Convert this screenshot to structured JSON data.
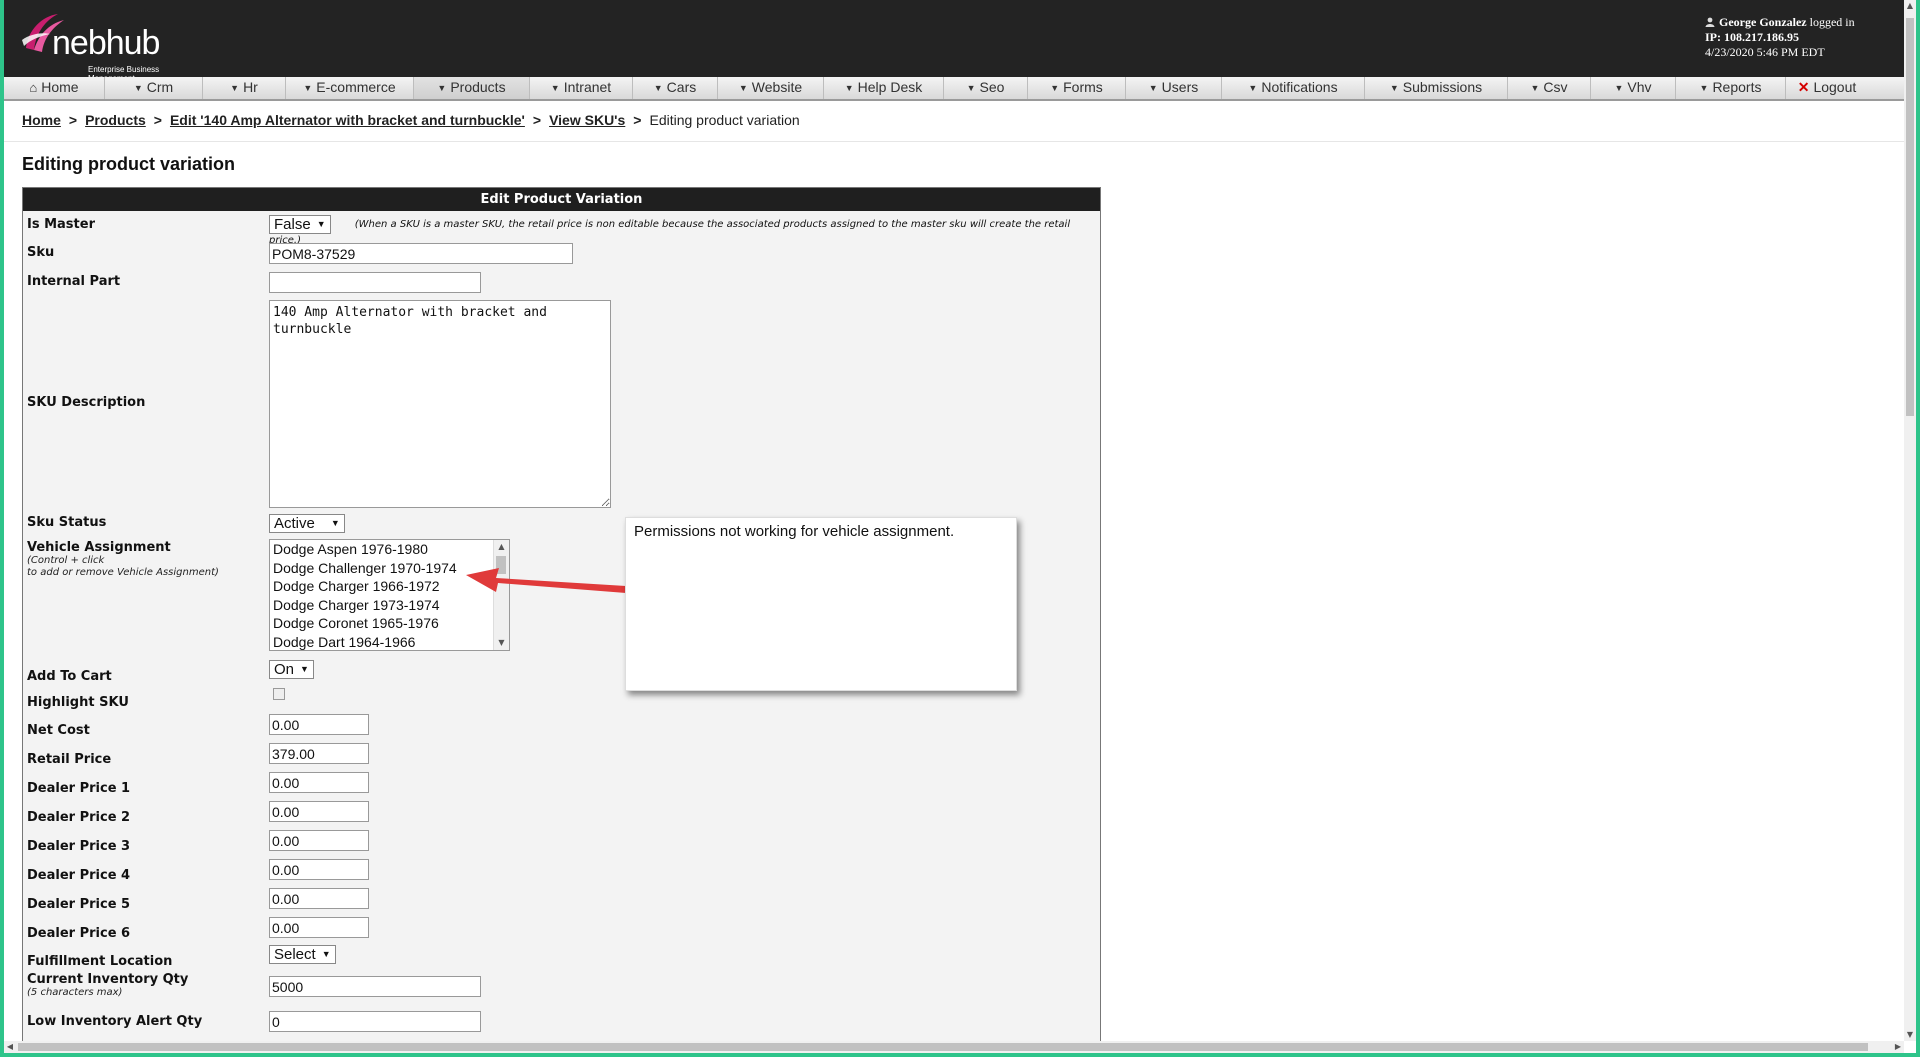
{
  "header": {
    "logo_text": "nebhub",
    "logo_tagline": "Enterprise Business Management",
    "user_name": "George Gonzalez",
    "logged_in_text": "logged in",
    "ip_line": "IP: 108.217.186.95",
    "datetime": "4/23/2020 5:46 PM EDT"
  },
  "nav": {
    "items": [
      "Home",
      "Crm",
      "Hr",
      "E-commerce",
      "Products",
      "Intranet",
      "Cars",
      "Website",
      "Help Desk",
      "Seo",
      "Forms",
      "Users",
      "Notifications",
      "Submissions",
      "Csv",
      "Vhv",
      "Reports",
      "Logout"
    ],
    "active": "Products"
  },
  "breadcrumb": {
    "home": "Home",
    "products": "Products",
    "edit_product": "Edit '140 Amp Alternator with bracket and turnbuckle'",
    "view_skus": "View SKU's",
    "current": "Editing product variation",
    "separator": ">"
  },
  "page_title": "Editing product variation",
  "form": {
    "header": "Edit Product Variation",
    "is_master": {
      "label": "Is Master",
      "value": "False",
      "note": "(When a SKU is a master SKU, the retail price is non editable because the associated products assigned to the master sku will create the retail price.)"
    },
    "sku": {
      "label": "Sku",
      "value": "POM8-37529"
    },
    "internal_part": {
      "label": "Internal Part",
      "value": ""
    },
    "sku_description": {
      "label": "SKU Description",
      "value": "140 Amp Alternator with bracket and turnbuckle"
    },
    "sku_status": {
      "label": "Sku Status",
      "value": "Active"
    },
    "vehicle_assignment": {
      "label": "Vehicle Assignment",
      "hint1": "(Control + click",
      "hint2": "to add or remove Vehicle Assignment)",
      "options": [
        "Dodge Aspen 1976-1980",
        "Dodge Challenger 1970-1974",
        "Dodge Charger 1966-1972",
        "Dodge Charger 1973-1974",
        "Dodge Coronet 1965-1976",
        "Dodge Dart 1964-1966"
      ]
    },
    "add_to_cart": {
      "label": "Add To Cart",
      "value": "On"
    },
    "highlight_sku": {
      "label": "Highlight SKU"
    },
    "net_cost": {
      "label": "Net Cost",
      "value": "0.00"
    },
    "retail_price": {
      "label": "Retail Price",
      "value": "379.00"
    },
    "dealer_price_1": {
      "label": "Dealer Price 1",
      "value": "0.00"
    },
    "dealer_price_2": {
      "label": "Dealer Price 2",
      "value": "0.00"
    },
    "dealer_price_3": {
      "label": "Dealer Price 3",
      "value": "0.00"
    },
    "dealer_price_4": {
      "label": "Dealer Price 4",
      "value": "0.00"
    },
    "dealer_price_5": {
      "label": "Dealer Price 5",
      "value": "0.00"
    },
    "dealer_price_6": {
      "label": "Dealer Price 6",
      "value": "0.00"
    },
    "fulfillment_location": {
      "label": "Fulfillment Location",
      "value": "Select"
    },
    "current_inventory_qty": {
      "label": "Current Inventory Qty",
      "hint": "(5 characters max)",
      "value": "5000"
    },
    "low_inventory_alert_qty": {
      "label": "Low Inventory Alert Qty",
      "value": "0"
    }
  },
  "annotation": {
    "text": "Permissions not working for vehicle assignment.",
    "arrow_color": "#e03a3a"
  },
  "colors": {
    "accent_border": "#2ec48a",
    "header_bg": "#232323",
    "logout_x": "#d40000"
  }
}
